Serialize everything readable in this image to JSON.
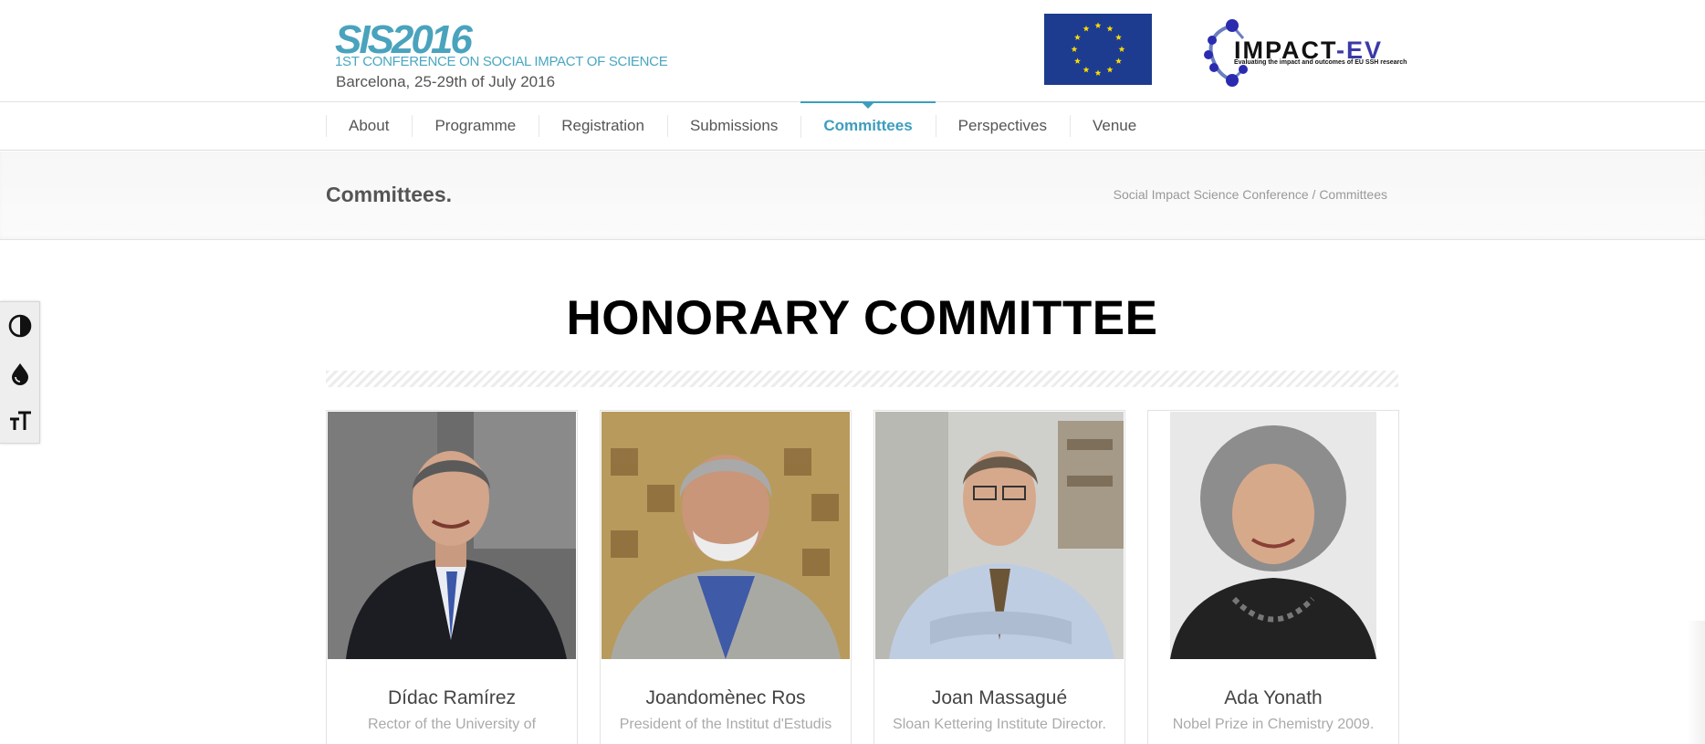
{
  "header": {
    "logo_mark": "SIS2016",
    "logo_subtitle": "1ST CONFERENCE ON SOCIAL IMPACT OF SCIENCE",
    "logo_dates": "Barcelona, 25-29th of July 2016",
    "impact_title_a": "IMPACT",
    "impact_title_b": "-EV",
    "impact_tagline": "Evaluating the impact and outcomes of EU SSH research",
    "colors": {
      "brand_blue": "#3d9dbd",
      "eu_blue": "#1d3c8f",
      "eu_star": "#ffdd00"
    }
  },
  "nav": {
    "items": [
      {
        "label": "About"
      },
      {
        "label": "Programme"
      },
      {
        "label": "Registration"
      },
      {
        "label": "Submissions"
      },
      {
        "label": "Committees",
        "active": true
      },
      {
        "label": "Perspectives"
      },
      {
        "label": "Venue"
      }
    ]
  },
  "title_bar": {
    "page_title": "Committees.",
    "breadcrumb_root": "Social Impact Science Conference",
    "breadcrumb_separator": " / ",
    "breadcrumb_current": "Committees"
  },
  "accessibility": {
    "buttons": [
      {
        "icon": "contrast-icon"
      },
      {
        "icon": "droplet-icon"
      },
      {
        "icon": "text-size-icon"
      }
    ]
  },
  "section": {
    "heading": "HONORARY COMMITTEE"
  },
  "members": [
    {
      "name": "Dídac Ramírez",
      "role": "Rector of the University of"
    },
    {
      "name": "Joandomènec Ros",
      "role": "President of the Institut d'Estudis"
    },
    {
      "name": "Joan Massagué",
      "role": "Sloan Kettering Institute Director."
    },
    {
      "name": "Ada Yonath",
      "role": "Nobel Prize in Chemistry 2009."
    }
  ]
}
